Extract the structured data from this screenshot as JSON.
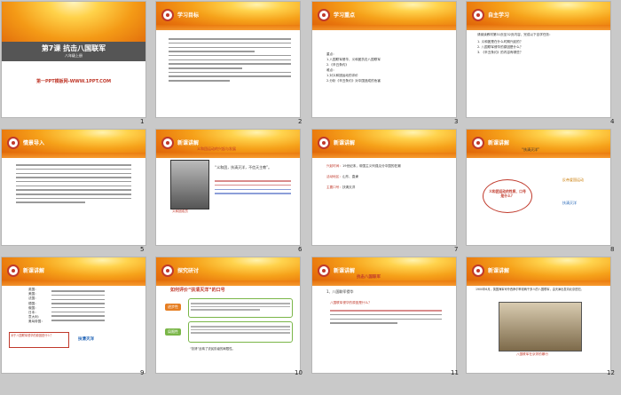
{
  "slides": [
    {
      "num": "1",
      "title": "第7课 抗击八国联军",
      "subtitle": "八年级上册",
      "footer": "第一PPT模板网-WWW.1PPT.COM"
    },
    {
      "num": "2",
      "header": "学习目标",
      "lines": [
        "1.了解八国联军侵华的原因，八国联军侵华的过程，掌握八国联军侵华的史实。",
        "2.通过学习义和团运动和八国联军侵华战争的史实，培养学生分析问题的能力。",
        "3.认识八国联军侵华的严重后果，激发学生的爱国热情。"
      ]
    },
    {
      "num": "3",
      "header": "学习重点",
      "items": [
        "重点：",
        "1.八国联军侵华，义和团抗击八国联军",
        "2.《辛丑条约》",
        "难点：",
        "1.对义和团运动的评价",
        "2.分析《辛丑条约》对中国造成的危害"
      ]
    },
    {
      "num": "4",
      "header": "自主学习",
      "intro": "请阅读教材第31页至32页内容，完成以下自学任务：",
      "items": [
        "1. 义和团是在什么时期兴起的？",
        "2. 八国联军侵华的原因是什么？",
        "3. 《辛丑条约》的内容有哪些？"
      ]
    },
    {
      "num": "5",
      "header": "情景导入",
      "lines": [
        "19世纪末帝国主义列强掀起瓜分中国的狂潮，中国面临着被瓜分的危险，以农民为主体的义和团运动兴起。"
      ]
    },
    {
      "num": "6",
      "header": "新课讲解",
      "redtitle": "义和团运动的兴起与发展",
      "quote": "“义和团，扶清灭洋，不信天主教”。",
      "caption": "义和团成员"
    },
    {
      "num": "7",
      "header": "新课讲解",
      "rows": [
        {
          "k": "兴起时间：",
          "v": "19世纪末，帝国主义列强瓜分中国的狂潮"
        },
        {
          "k": "活动地区：",
          "v": "山东、直隶"
        },
        {
          "k": "主要口号：",
          "v": "扶清灭洋"
        }
      ]
    },
    {
      "num": "8",
      "header": "新课讲解",
      "quote": "“扶清灭洋”",
      "cloud": "义和团运动的性质、口号是什么？",
      "answer1": "反帝爱国运动",
      "answer2": "扶清灭洋"
    },
    {
      "num": "9",
      "header": "新课讲解",
      "items": [
        "英国：",
        "美国：",
        "法国：",
        "德国：",
        "俄国：",
        "日本：",
        "意大利：",
        "奥匈帝国："
      ],
      "question": "对于八国联军侵华的原因是什么？",
      "answer": "扶清灭洋"
    },
    {
      "num": "10",
      "header": "探究研讨",
      "redtitle": "如何评价“扶清灭洋”的口号",
      "labels": [
        "进步性",
        "局限性"
      ],
      "foot": "“扶清”反映了农民阶级的局限性。"
    },
    {
      "num": "11",
      "header": "新课讲解",
      "redtitle": "抗击八国联军",
      "item": "1、八国联军侵华",
      "q": "八国联军侵华的原因是什么？"
    },
    {
      "num": "12",
      "header": "新课讲解",
      "intro": "1900年6月，英国海军司令西摩尔率领两千多人的八国联军，由天津出发向北京进犯。",
      "caption": "八国联军在京郊的暴行"
    }
  ],
  "colors": {
    "banner": "#f6a21a",
    "accent": "#c0392b",
    "blue": "#1a5fb4",
    "green": "#2e7d32"
  }
}
